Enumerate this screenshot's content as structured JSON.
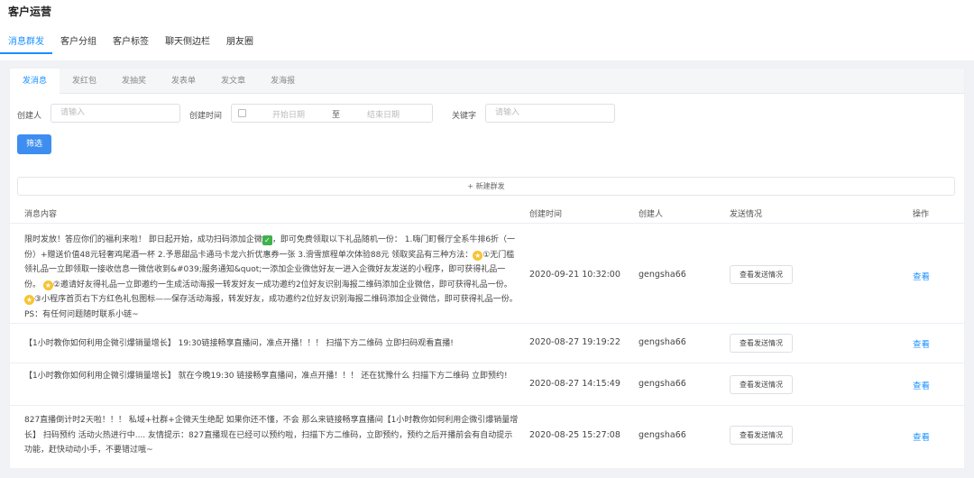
{
  "page_title": "客户运营",
  "top_tabs": [
    "消息群发",
    "客户分组",
    "客户标签",
    "聊天侧边栏",
    "朋友圈"
  ],
  "inner_tabs": [
    "发消息",
    "发红包",
    "发抽奖",
    "发表单",
    "发文章",
    "发海报"
  ],
  "filters": {
    "creator_label": "创建人",
    "creator_placeholder": "请输入",
    "time_label": "创建时间",
    "start_placeholder": "开始日期",
    "separator": "至",
    "end_placeholder": "结束日期",
    "keyword_label": "关键字",
    "keyword_placeholder": "请输入",
    "filter_button": "筛选"
  },
  "new_button": "+ 新建群发",
  "columns": [
    "消息内容",
    "创建时间",
    "创建人",
    "发送情况",
    "操作"
  ],
  "rows": [
    {
      "content_parts": {
        "a": "限时发放！答应你们的福利来啦！ 即日起开始，成功扫码添加企微",
        "b": "，即可免费领取以下礼品随机一份： 1.嗨门町餐厅全系牛排6折（一份）+赠送价值48元轻奢鸡尾酒一杯 2.予恩甜品卡通马卡龙六折优惠券一张 3.滑雪旅程单次体验88元 领取奖品有三种方法：",
        "c": "①无门槛领礼品一立即领取一接收信息一微信收到&#039;服务通知&quot;一添加企业微信好友一进入企微好友发送的小程序，即可获得礼品一份。",
        "d": "②邀请好友得礼品一立即邀约一生成活动海报一转发好友一成功邀约2位好友识别海报二维码添加企业微信，即可获得礼品一份。",
        "e": "③小程序首页右下方红色礼包图标——保存活动海报，转发好友，成功邀约2位好友识别海报二维码添加企业微信，即可获得礼品一份。 PS：有任何问题随时联系小链~"
      },
      "time": "2020-09-21 10:32:00",
      "creator": "gengsha66",
      "send_button": "查看发送情况",
      "action": "查看"
    },
    {
      "content": "【1小时教你如何利用企微引爆销量增长】 19:30链接畅享直播间，准点开播！！！ 扫描下方二维码 立即扫码观看直播!",
      "time": "2020-08-27 19:19:22",
      "creator": "gengsha66",
      "send_button": "查看发送情况",
      "action": "查看"
    },
    {
      "content": "【1小时教你如何利用企微引爆销量增长】 就在今晚19:30 链接畅享直播间，准点开播！！！ 还在犹豫什么 扫描下方二维码 立即预约!",
      "time": "2020-08-27 14:15:49",
      "creator": "gengsha66",
      "send_button": "查看发送情况",
      "action": "查看"
    },
    {
      "content": "827直播倒计时2天啦！！！ 私域+社群+企微天生绝配 如果你还不懂，不会 那么来链接畅享直播间【1小时教你如何利用企微引爆销量增长】 扫码预约 活动火热进行中.... 友情提示：827直播现在已经可以预约啦，扫描下方二维码，立即预约，预约之后开播前会有自动提示功能，赶快动动小手，不要错过哦~",
      "time": "2020-08-25 15:27:08",
      "creator": "gengsha66",
      "send_button": "查看发送情况",
      "action": "查看"
    }
  ]
}
